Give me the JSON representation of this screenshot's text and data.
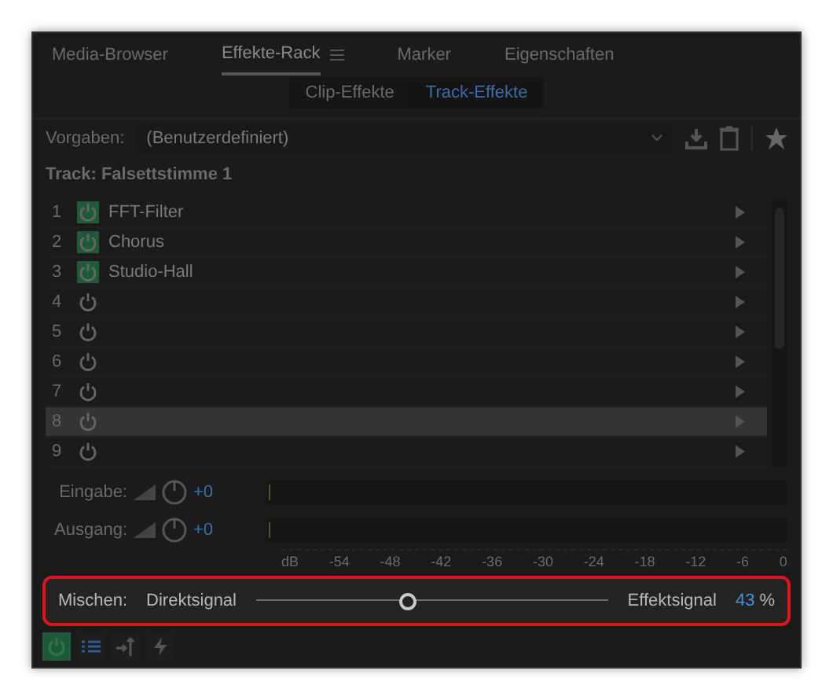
{
  "tabs": [
    {
      "label": "Media-Browser",
      "selected": false
    },
    {
      "label": "Effekte-Rack",
      "selected": true
    },
    {
      "label": "Marker",
      "selected": false
    },
    {
      "label": "Eigenschaften",
      "selected": false
    }
  ],
  "subtabs": [
    {
      "label": "Clip-Effekte",
      "selected": false
    },
    {
      "label": "Track-Effekte",
      "selected": true
    }
  ],
  "presets": {
    "label": "Vorgaben:",
    "value": "(Benutzerdefiniert)"
  },
  "track": "Track: Falsettstimme 1",
  "effects": [
    {
      "number": "1",
      "name": "FFT-Filter",
      "on": true,
      "selected": false
    },
    {
      "number": "2",
      "name": "Chorus",
      "on": true,
      "selected": false
    },
    {
      "number": "3",
      "name": "Studio-Hall",
      "on": true,
      "selected": false
    },
    {
      "number": "4",
      "on": false,
      "selected": false
    },
    {
      "number": "5",
      "on": false,
      "selected": false
    },
    {
      "number": "6",
      "on": false,
      "selected": false
    },
    {
      "number": "7",
      "on": false,
      "selected": false
    },
    {
      "number": "8",
      "on": false,
      "selected": true
    },
    {
      "number": "9",
      "on": false,
      "selected": false
    }
  ],
  "levels": [
    {
      "label": "Eingabe:",
      "value": "+0"
    },
    {
      "label": "Ausgang:",
      "value": "+0"
    }
  ],
  "scale": [
    "dB",
    "-54",
    "-48",
    "-42",
    "-36",
    "-30",
    "-24",
    "-18",
    "-12",
    "-6",
    "0"
  ],
  "mix": {
    "label": "Mischen:",
    "left": "Direktsignal",
    "right": "Effektsignal",
    "level": 0.43,
    "value": "43",
    "unit": "%"
  },
  "toolbar": [
    {
      "kind": "power",
      "on": true
    },
    {
      "kind": "list",
      "on": false
    },
    {
      "kind": "route",
      "on": false
    },
    {
      "kind": "bolt",
      "on": false
    }
  ]
}
